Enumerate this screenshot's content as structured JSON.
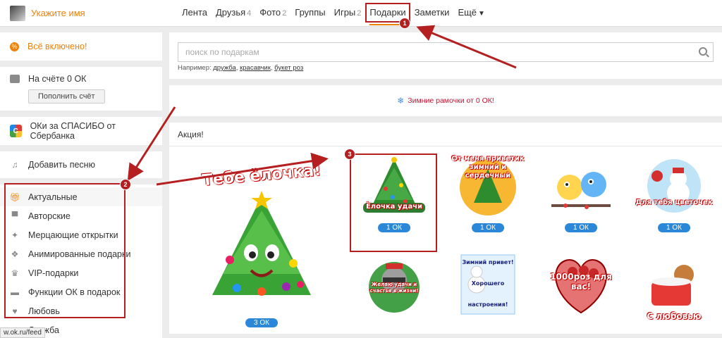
{
  "header": {
    "username": "Укажите имя",
    "nav": [
      {
        "label": "Лента",
        "count": ""
      },
      {
        "label": "Друзья",
        "count": "4"
      },
      {
        "label": "Фото",
        "count": "2"
      },
      {
        "label": "Группы",
        "count": ""
      },
      {
        "label": "Игры",
        "count": "2"
      },
      {
        "label": "Подарки",
        "count": ""
      },
      {
        "label": "Заметки",
        "count": ""
      },
      {
        "label": "Ещё",
        "count": ""
      }
    ]
  },
  "sidebar": {
    "all_included": "Всё включено!",
    "balance_text": "На счёте 0 ОК",
    "topup_label": "Пополнить счёт",
    "sber_label": "ОКи за СПАСИБО от Сбербанка",
    "song_label": "Добавить песню",
    "categories": [
      {
        "label": "Актуальные",
        "icon": "gift-icon"
      },
      {
        "label": "Авторские",
        "icon": "author-icon"
      },
      {
        "label": "Мерцающие открытки",
        "icon": "sparkle-icon"
      },
      {
        "label": "Анимированные подарки",
        "icon": "animated-icon"
      },
      {
        "label": "VIP-подарки",
        "icon": "crown-icon"
      },
      {
        "label": "Функции ОК в подарок",
        "icon": "hat-icon"
      },
      {
        "label": "Любовь",
        "icon": "heart-icon"
      },
      {
        "label": "Дружба",
        "icon": "friends-icon"
      }
    ]
  },
  "search": {
    "placeholder": "поиск по подаркам",
    "hint_prefix": "Например:",
    "examples": [
      "дружба",
      "красавчик",
      "букет роз"
    ]
  },
  "promo": {
    "text": "Зимние рамочки от 0 ОК!"
  },
  "gifts": {
    "heading": "Акция!",
    "featured": {
      "caption": "Тебе ёлочка!",
      "price": "3 ОК"
    },
    "items": [
      {
        "caption": "Ёлочка удачи",
        "price": "1 ОК"
      },
      {
        "caption": "От меня приветик зимний и сердечный",
        "price": "1 ОК"
      },
      {
        "caption": "",
        "price": "1 ОК"
      },
      {
        "caption": "Для тебя цветочек",
        "price": "1 ОК"
      },
      {
        "caption": "Желаю удачи и счастья в жизни!",
        "price": ""
      },
      {
        "caption": "Зимний привет! Хорошего настроения!",
        "price": ""
      },
      {
        "caption": "1000роз для вас!",
        "price": ""
      },
      {
        "caption": "С любовью",
        "price": ""
      }
    ]
  },
  "annotations": {
    "badge1": "1",
    "badge2": "2",
    "badge3": "3"
  },
  "status_url": "w.ok.ru/feed",
  "colors": {
    "accent": "#ee8208",
    "annotation": "#b51f1f",
    "price": "#2b88d8"
  }
}
